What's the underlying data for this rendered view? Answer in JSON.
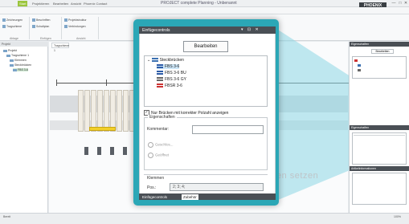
{
  "app": {
    "title": "PROJECT complete Planning - Unbenannt",
    "brand": "PHOENIX",
    "window_controls": [
      "—",
      "□",
      "✕"
    ]
  },
  "menu": [
    "Start",
    "Projektieren",
    "Bearbeiten",
    "Ansicht",
    "Phoenix Contact"
  ],
  "ribbon": {
    "items": [
      "Zeichnungen",
      "Tragschiene",
      "Beschriften",
      "Schaltplan",
      "Projektstruktur",
      "Verbindungen"
    ],
    "groups": [
      "Ablage",
      "Einfügen",
      "Ansicht"
    ]
  },
  "tree": {
    "header": "Projekt",
    "items": [
      "Projekt",
      "Tragschiene 1",
      "Klemmen",
      "Steckbrücken",
      "FBS 3-6"
    ]
  },
  "canvas": {
    "tab": "Tragschiene 1",
    "ghost_text": "xen setzen"
  },
  "dialog": {
    "title": "Einfügecontrols",
    "controls": "▾ ⊡ ✕",
    "edit_button": "Bearbeiten",
    "tree": {
      "root": "Steckbrücken",
      "items": [
        {
          "label": "FBS 3-6",
          "icon": "bridge-icon",
          "color": "#2d5ca8",
          "selected": true
        },
        {
          "label": "FBS 3-6 BU",
          "icon": "bridge-icon",
          "color": "#2d5ca8",
          "selected": false
        },
        {
          "label": "FBS 3-6 GY",
          "icon": "bridge-icon",
          "color": "#666666",
          "selected": false
        },
        {
          "label": "FBSR 3-6",
          "icon": "bridge-icon",
          "color": "#cc3333",
          "selected": false
        }
      ]
    },
    "checkbox_label": "Nur Brücken mit korrekter Polzahl anzeigen",
    "checkbox_checked": true,
    "properties": {
      "legend": "Eigenschaften",
      "comment_label": "Kommentar:",
      "comment_value": "",
      "radio1": "Geschlos...",
      "radio2": "Geöffnet"
    },
    "terminals": {
      "legend": "Klemmen",
      "pos_label": "Pos.:",
      "pos_value": "2; 3; 4;"
    },
    "tabs": [
      "Einfügecontrols",
      "Zubehör"
    ]
  },
  "right_panel": {
    "header1": "Eigenschaften",
    "edit": "Bearbeiten",
    "header2": "Eigenschaften",
    "header3": "Artikelinformationen"
  },
  "status": [
    "Bereit",
    "100%"
  ],
  "colors": {
    "accent": "#2ba7b6",
    "dialog_title": "#4a4f55",
    "bridge_yellow": "#f2cf2a"
  }
}
